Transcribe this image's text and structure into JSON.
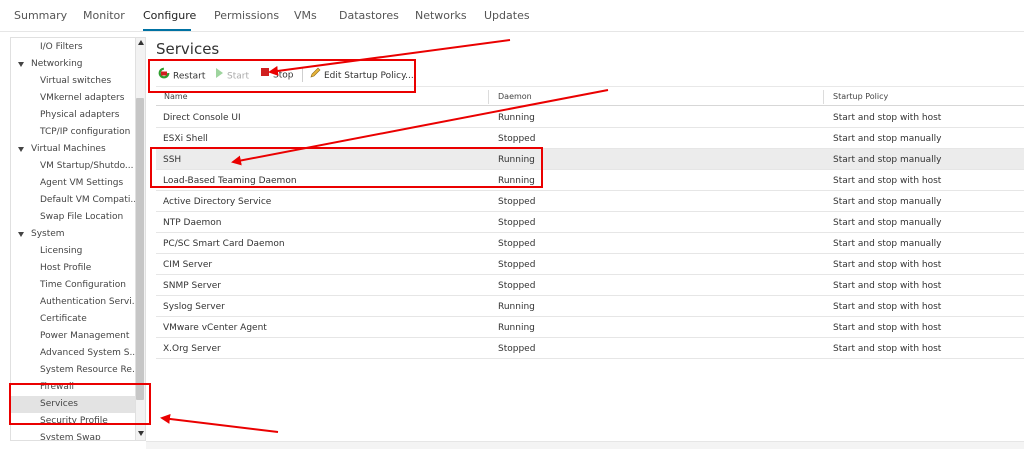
{
  "tabs": [
    {
      "label": "Summary"
    },
    {
      "label": "Monitor"
    },
    {
      "label": "Configure",
      "active": true
    },
    {
      "label": "Permissions"
    },
    {
      "label": "VMs"
    },
    {
      "label": "Datastores"
    },
    {
      "label": "Networks"
    },
    {
      "label": "Updates"
    }
  ],
  "sidebar": {
    "items": [
      {
        "label": "I/O Filters",
        "type": "child"
      },
      {
        "label": "Networking",
        "type": "group"
      },
      {
        "label": "Virtual switches",
        "type": "child"
      },
      {
        "label": "VMkernel adapters",
        "type": "child"
      },
      {
        "label": "Physical adapters",
        "type": "child"
      },
      {
        "label": "TCP/IP configuration",
        "type": "child"
      },
      {
        "label": "Virtual Machines",
        "type": "group"
      },
      {
        "label": "VM Startup/Shutdo...",
        "type": "child"
      },
      {
        "label": "Agent VM Settings",
        "type": "child"
      },
      {
        "label": "Default VM Compati...",
        "type": "child"
      },
      {
        "label": "Swap File Location",
        "type": "child"
      },
      {
        "label": "System",
        "type": "group"
      },
      {
        "label": "Licensing",
        "type": "child"
      },
      {
        "label": "Host Profile",
        "type": "child"
      },
      {
        "label": "Time Configuration",
        "type": "child"
      },
      {
        "label": "Authentication Servi...",
        "type": "child"
      },
      {
        "label": "Certificate",
        "type": "child"
      },
      {
        "label": "Power Management",
        "type": "child"
      },
      {
        "label": "Advanced System S...",
        "type": "child"
      },
      {
        "label": "System Resource Re...",
        "type": "child"
      },
      {
        "label": "Firewall",
        "type": "child"
      },
      {
        "label": "Services",
        "type": "child",
        "selected": true
      },
      {
        "label": "Security Profile",
        "type": "child"
      },
      {
        "label": "System Swap",
        "type": "child"
      }
    ]
  },
  "main": {
    "title": "Services",
    "toolbar": {
      "restart_label": "Restart",
      "start_label": "Start",
      "stop_label": "Stop",
      "edit_label": "Edit Startup Policy..."
    },
    "columns": {
      "name": "Name",
      "daemon": "Daemon",
      "policy": "Startup Policy"
    },
    "rows": [
      {
        "name": "Direct Console UI",
        "daemon": "Running",
        "policy": "Start and stop with host"
      },
      {
        "name": "ESXi Shell",
        "daemon": "Stopped",
        "policy": "Start and stop manually"
      },
      {
        "name": "SSH",
        "daemon": "Running",
        "policy": "Start and stop manually",
        "selected": true
      },
      {
        "name": "Load-Based Teaming Daemon",
        "daemon": "Running",
        "policy": "Start and stop with host"
      },
      {
        "name": "Active Directory Service",
        "daemon": "Stopped",
        "policy": "Start and stop manually"
      },
      {
        "name": "NTP Daemon",
        "daemon": "Stopped",
        "policy": "Start and stop manually"
      },
      {
        "name": "PC/SC Smart Card Daemon",
        "daemon": "Stopped",
        "policy": "Start and stop manually"
      },
      {
        "name": "CIM Server",
        "daemon": "Stopped",
        "policy": "Start and stop with host"
      },
      {
        "name": "SNMP Server",
        "daemon": "Stopped",
        "policy": "Start and stop with host"
      },
      {
        "name": "Syslog Server",
        "daemon": "Running",
        "policy": "Start and stop with host"
      },
      {
        "name": "VMware vCenter Agent",
        "daemon": "Running",
        "policy": "Start and stop with host"
      },
      {
        "name": "X.Org Server",
        "daemon": "Stopped",
        "policy": "Start and stop with host"
      }
    ]
  },
  "colors": {
    "annotation": "#ea0000",
    "accent": "#0072a3",
    "restart_icon": "#2e9e2e",
    "stop_icon": "#d01f1f",
    "start_icon_disabled": "#9ed49e"
  },
  "icons": {
    "restart": "restart-icon",
    "start": "play-icon",
    "stop": "stop-icon",
    "edit": "pencil-icon"
  }
}
